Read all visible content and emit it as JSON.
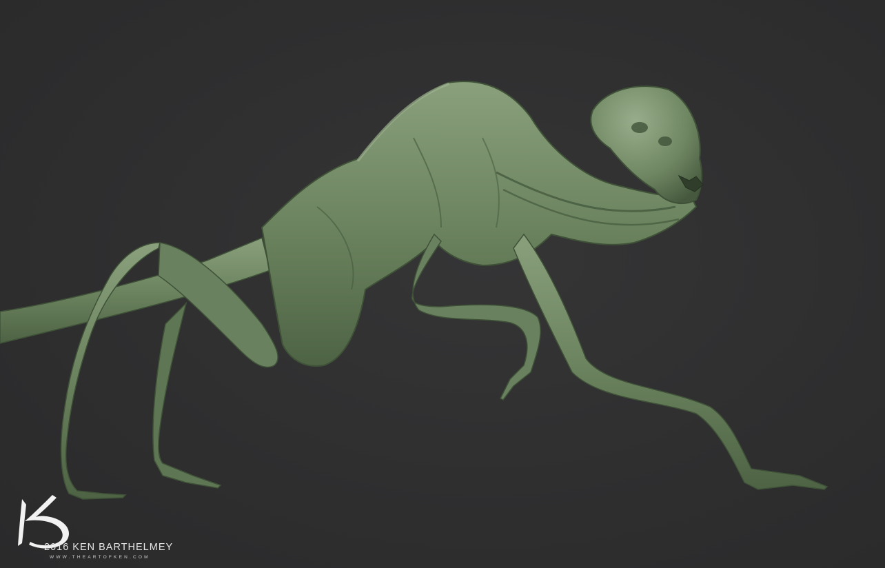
{
  "image": {
    "subject": "green clay 3D sculpt of a crawling alien creature",
    "background_color": "#2f2f30",
    "creature_color": "#6d8460",
    "creature_shadow_color": "#3f5238",
    "creature_highlight_color": "#93a886"
  },
  "watermark": {
    "logo_icon": "kb-monogram-icon",
    "copyright": "2016 KEN BARTHELMEY",
    "website": "WWW.THEARTOFKEN.COM"
  }
}
